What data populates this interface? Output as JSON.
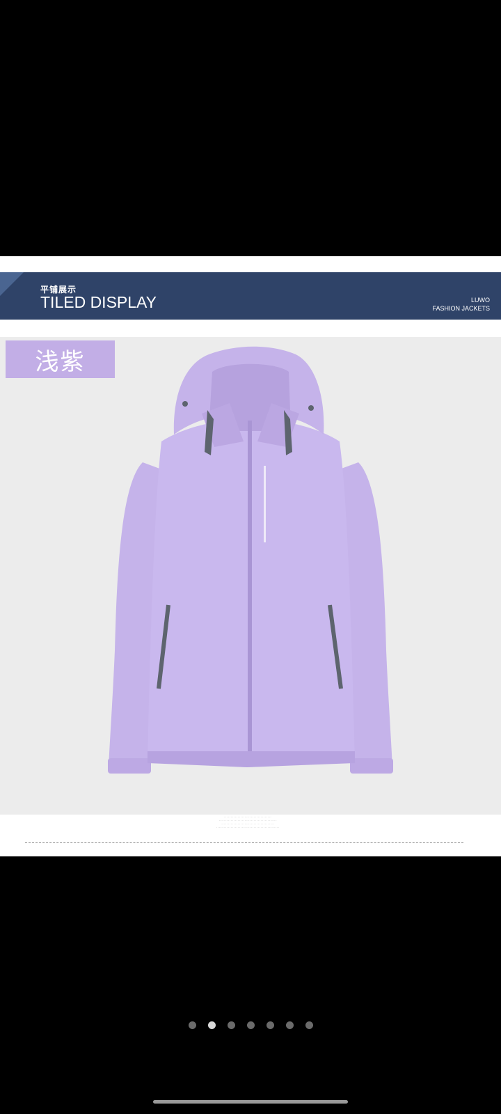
{
  "banner": {
    "title_cn": "平铺展示",
    "title_en": "TILED DISPLAY",
    "brand_line1": "LUWO",
    "brand_line2": "FASHION JACKETS"
  },
  "product": {
    "color_label": "浅紫",
    "colors": {
      "jacket": "#c5b3ea",
      "jacket_shadow": "#b09ad8",
      "tag": "#c2aee6",
      "banner": "#2f4368",
      "trim": "#5d646e"
    }
  },
  "pager": {
    "total": 7,
    "active_index": 1
  }
}
